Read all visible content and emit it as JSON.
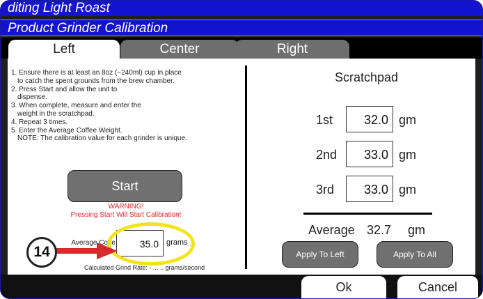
{
  "header": {
    "title": "diting Light Roast",
    "subtitle": "Product Grinder Calibration"
  },
  "tabs": [
    {
      "label": "Left",
      "active": true
    },
    {
      "label": "Center",
      "active": false
    },
    {
      "label": "Right",
      "active": false
    }
  ],
  "instructions": [
    "1. Ensure there is at least an 8oz (~240ml) cup in place",
    "    to catch the spent grounds from the brew chamber.",
    "2. Press Start and allow the unit to",
    "    dispense.",
    "3. When complete, measure and enter the",
    "    weight in the scratchpad.",
    "4. Repeat 3 times.",
    "5. Enter the Average Coffee Weight.",
    "    NOTE:  The calibration value for each grinder is unique."
  ],
  "start_button": "Start",
  "warning": {
    "line1": "WARNING!",
    "line2": "Pressing Start Will Start Calibration!"
  },
  "average_field": {
    "label_line1": "Average Coffe",
    "label_line2": "We",
    "value": "35.0",
    "unit": "grams"
  },
  "annotation_number": "14",
  "grind_rate": "Calculated Grind Rate: - ... .. grams/second",
  "scratchpad": {
    "title": "Scratchpad",
    "rows": [
      {
        "label": "1st",
        "value": "32.0",
        "unit": "gm"
      },
      {
        "label": "2nd",
        "value": "33.0",
        "unit": "gm"
      },
      {
        "label": "3rd",
        "value": "33.0",
        "unit": "gm"
      }
    ],
    "average_label": "Average",
    "average_value": "32.7",
    "average_unit": "gm",
    "apply_left": "Apply To Left",
    "apply_all": "Apply To All"
  },
  "footer": {
    "ok": "Ok",
    "cancel": "Cancel"
  },
  "colors": {
    "title_bar": "#1414d0",
    "annotation_highlight": "#f2e31c",
    "annotation_arrow": "#d82a2a",
    "warning_text": "#e0262a",
    "button_gray": "#707070"
  }
}
